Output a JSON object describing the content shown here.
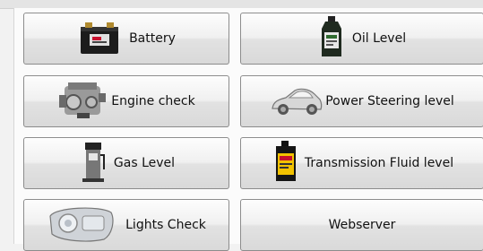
{
  "buttons": {
    "battery": {
      "label": "Battery",
      "icon": "car-battery-icon"
    },
    "oil_level": {
      "label": "Oil Level",
      "icon": "oil-bottle-icon"
    },
    "engine_check": {
      "label": "Engine check",
      "icon": "engine-icon"
    },
    "power_steering": {
      "label": "Power Steering level",
      "icon": "car-icon"
    },
    "gas_level": {
      "label": "Gas Level",
      "icon": "gas-pump-icon"
    },
    "transmission_fluid": {
      "label": "Transmission Fluid level",
      "icon": "fluid-jug-icon"
    },
    "lights_check": {
      "label": "Lights Check",
      "icon": "headlight-icon"
    },
    "webserver": {
      "label": "Webserver"
    }
  },
  "colors": {
    "button_border": "#8c8c8c",
    "button_top": "#fdfdfd",
    "button_bottom": "#d9d9d9",
    "text": "#111111"
  }
}
